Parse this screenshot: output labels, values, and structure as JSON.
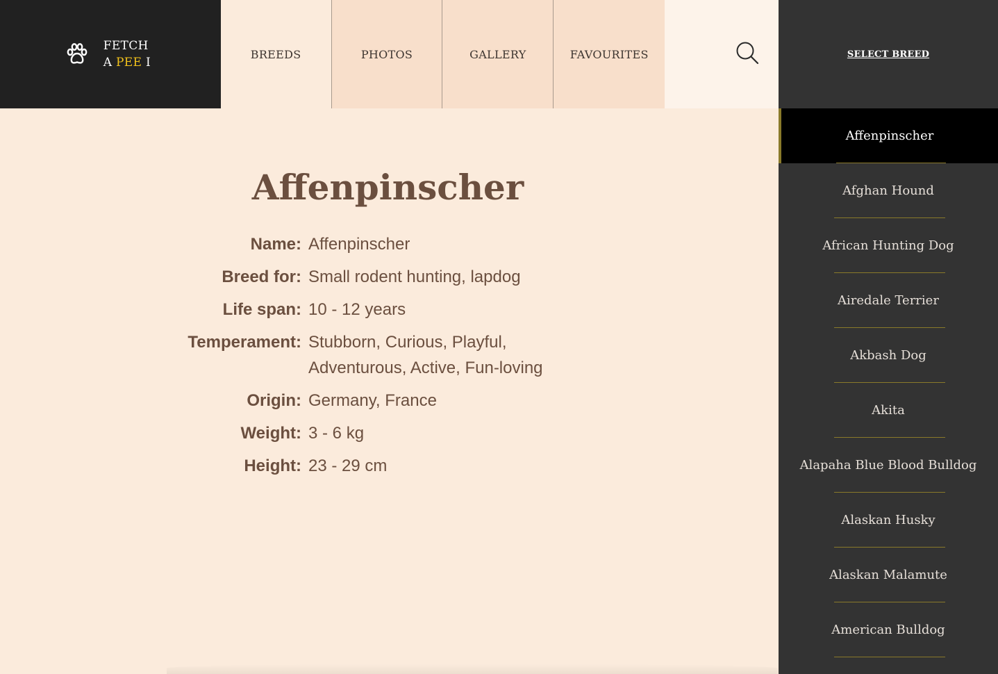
{
  "logo": {
    "line1": "FETCH",
    "line2_prefix": "A",
    "line2_highlight": "PEE",
    "line2_suffix": "I",
    "icon": "paw-icon",
    "highlight_color": "#f2c21b"
  },
  "nav": {
    "tabs": [
      {
        "label": "BREEDS",
        "active": true
      },
      {
        "label": "PHOTOS",
        "active": false
      },
      {
        "label": "GALLERY",
        "active": false
      },
      {
        "label": "FAVOURITES",
        "active": false
      }
    ],
    "search_icon": "search-icon"
  },
  "sidebar": {
    "select_label": "SELECT BREED",
    "breeds": [
      "Affenpinscher",
      "Afghan Hound",
      "African Hunting Dog",
      "Airedale Terrier",
      "Akbash Dog",
      "Akita",
      "Alapaha Blue Blood Bulldog",
      "Alaskan Husky",
      "Alaskan Malamute",
      "American Bulldog"
    ],
    "selected": "Affenpinscher"
  },
  "breed": {
    "title": "Affenpinscher",
    "fields": [
      {
        "label": "Name:",
        "value": "Affenpinscher"
      },
      {
        "label": "Breed for:",
        "value": "Small rodent hunting, lapdog"
      },
      {
        "label": "Life span:",
        "value": "10 - 12 years"
      },
      {
        "label": "Temperament:",
        "value": "Stubborn, Curious, Playful, Adventurous, Active, Fun-loving"
      },
      {
        "label": "Origin:",
        "value": "Germany, France"
      },
      {
        "label": "Weight:",
        "value": "3 - 6 kg"
      },
      {
        "label": "Height:",
        "value": "23 - 29 cm"
      }
    ]
  },
  "colors": {
    "header_dark": "#212121",
    "sidebar_bg": "#333333",
    "page_bg": "#fbebdc",
    "tab_bg": "#f8dfcb",
    "text_brown": "#6b4f3f",
    "accent_olive": "#8a7a2a"
  }
}
